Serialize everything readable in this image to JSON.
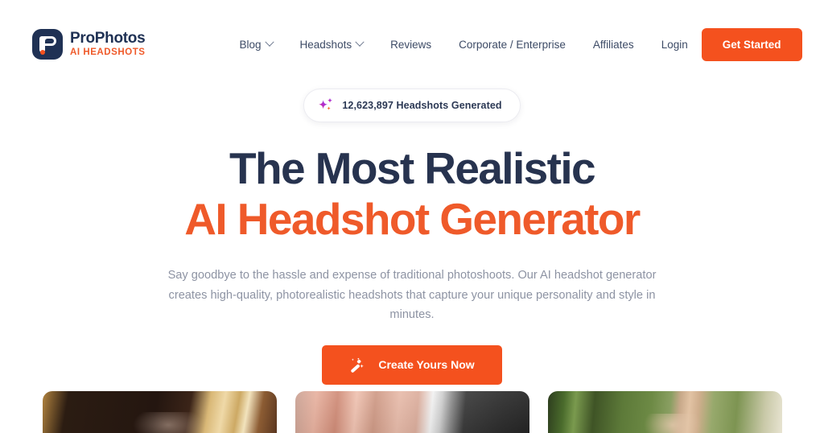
{
  "brand": {
    "name": "ProPhotos",
    "tagline": "AI HEADSHOTS",
    "logo_icon": "prophotos-logo-icon",
    "mark_color": "#1f3154",
    "accent_color": "#f4511e"
  },
  "nav": {
    "items": [
      {
        "label": "Blog",
        "has_dropdown": true
      },
      {
        "label": "Headshots",
        "has_dropdown": true
      },
      {
        "label": "Reviews",
        "has_dropdown": false
      },
      {
        "label": "Corporate / Enterprise",
        "has_dropdown": false
      },
      {
        "label": "Affiliates",
        "has_dropdown": false
      },
      {
        "label": "Login",
        "has_dropdown": false
      }
    ],
    "cta_label": "Get Started"
  },
  "hero": {
    "badge": {
      "icon": "sparkles-icon",
      "count": "12,623,897",
      "text": "12,623,897 Headshots Generated"
    },
    "headline_line1": "The Most Realistic",
    "headline_line2": "AI Headshot Generator",
    "headline_line1_color": "#27334f",
    "headline_line2_color": "#ef5a2a",
    "subtext": "Say goodbye to the hassle and expense of traditional photoshoots. Our AI headshot generator creates high-quality, photorealistic headshots that capture your unique personality and style in minutes.",
    "cta": {
      "label": "Create Yours Now",
      "icon": "magic-wand-icon",
      "color": "#f4511e"
    }
  },
  "gallery": {
    "cards": [
      {
        "alt": "headshot-sample-1"
      },
      {
        "alt": "headshot-sample-2"
      },
      {
        "alt": "headshot-sample-3"
      }
    ]
  }
}
